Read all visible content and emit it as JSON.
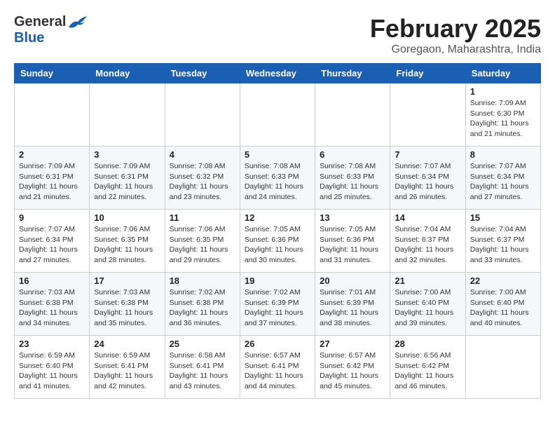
{
  "header": {
    "logo_general": "General",
    "logo_blue": "Blue",
    "month_title": "February 2025",
    "location": "Goregaon, Maharashtra, India"
  },
  "calendar": {
    "days_of_week": [
      "Sunday",
      "Monday",
      "Tuesday",
      "Wednesday",
      "Thursday",
      "Friday",
      "Saturday"
    ],
    "weeks": [
      [
        {
          "day": "",
          "info": ""
        },
        {
          "day": "",
          "info": ""
        },
        {
          "day": "",
          "info": ""
        },
        {
          "day": "",
          "info": ""
        },
        {
          "day": "",
          "info": ""
        },
        {
          "day": "",
          "info": ""
        },
        {
          "day": "1",
          "info": "Sunrise: 7:09 AM\nSunset: 6:30 PM\nDaylight: 11 hours\nand 21 minutes."
        }
      ],
      [
        {
          "day": "2",
          "info": "Sunrise: 7:09 AM\nSunset: 6:31 PM\nDaylight: 11 hours\nand 21 minutes."
        },
        {
          "day": "3",
          "info": "Sunrise: 7:09 AM\nSunset: 6:31 PM\nDaylight: 11 hours\nand 22 minutes."
        },
        {
          "day": "4",
          "info": "Sunrise: 7:08 AM\nSunset: 6:32 PM\nDaylight: 11 hours\nand 23 minutes."
        },
        {
          "day": "5",
          "info": "Sunrise: 7:08 AM\nSunset: 6:33 PM\nDaylight: 11 hours\nand 24 minutes."
        },
        {
          "day": "6",
          "info": "Sunrise: 7:08 AM\nSunset: 6:33 PM\nDaylight: 11 hours\nand 25 minutes."
        },
        {
          "day": "7",
          "info": "Sunrise: 7:07 AM\nSunset: 6:34 PM\nDaylight: 11 hours\nand 26 minutes."
        },
        {
          "day": "8",
          "info": "Sunrise: 7:07 AM\nSunset: 6:34 PM\nDaylight: 11 hours\nand 27 minutes."
        }
      ],
      [
        {
          "day": "9",
          "info": "Sunrise: 7:07 AM\nSunset: 6:34 PM\nDaylight: 11 hours\nand 27 minutes."
        },
        {
          "day": "10",
          "info": "Sunrise: 7:06 AM\nSunset: 6:35 PM\nDaylight: 11 hours\nand 28 minutes."
        },
        {
          "day": "11",
          "info": "Sunrise: 7:06 AM\nSunset: 6:35 PM\nDaylight: 11 hours\nand 29 minutes."
        },
        {
          "day": "12",
          "info": "Sunrise: 7:05 AM\nSunset: 6:36 PM\nDaylight: 11 hours\nand 30 minutes."
        },
        {
          "day": "13",
          "info": "Sunrise: 7:05 AM\nSunset: 6:36 PM\nDaylight: 11 hours\nand 31 minutes."
        },
        {
          "day": "14",
          "info": "Sunrise: 7:04 AM\nSunset: 6:37 PM\nDaylight: 11 hours\nand 32 minutes."
        },
        {
          "day": "15",
          "info": "Sunrise: 7:04 AM\nSunset: 6:37 PM\nDaylight: 11 hours\nand 33 minutes."
        }
      ],
      [
        {
          "day": "16",
          "info": "Sunrise: 7:03 AM\nSunset: 6:38 PM\nDaylight: 11 hours\nand 34 minutes."
        },
        {
          "day": "17",
          "info": "Sunrise: 7:03 AM\nSunset: 6:38 PM\nDaylight: 11 hours\nand 35 minutes."
        },
        {
          "day": "18",
          "info": "Sunrise: 7:02 AM\nSunset: 6:38 PM\nDaylight: 11 hours\nand 36 minutes."
        },
        {
          "day": "19",
          "info": "Sunrise: 7:02 AM\nSunset: 6:39 PM\nDaylight: 11 hours\nand 37 minutes."
        },
        {
          "day": "20",
          "info": "Sunrise: 7:01 AM\nSunset: 6:39 PM\nDaylight: 11 hours\nand 38 minutes."
        },
        {
          "day": "21",
          "info": "Sunrise: 7:00 AM\nSunset: 6:40 PM\nDaylight: 11 hours\nand 39 minutes."
        },
        {
          "day": "22",
          "info": "Sunrise: 7:00 AM\nSunset: 6:40 PM\nDaylight: 11 hours\nand 40 minutes."
        }
      ],
      [
        {
          "day": "23",
          "info": "Sunrise: 6:59 AM\nSunset: 6:40 PM\nDaylight: 11 hours\nand 41 minutes."
        },
        {
          "day": "24",
          "info": "Sunrise: 6:59 AM\nSunset: 6:41 PM\nDaylight: 11 hours\nand 42 minutes."
        },
        {
          "day": "25",
          "info": "Sunrise: 6:58 AM\nSunset: 6:41 PM\nDaylight: 11 hours\nand 43 minutes."
        },
        {
          "day": "26",
          "info": "Sunrise: 6:57 AM\nSunset: 6:41 PM\nDaylight: 11 hours\nand 44 minutes."
        },
        {
          "day": "27",
          "info": "Sunrise: 6:57 AM\nSunset: 6:42 PM\nDaylight: 11 hours\nand 45 minutes."
        },
        {
          "day": "28",
          "info": "Sunrise: 6:56 AM\nSunset: 6:42 PM\nDaylight: 11 hours\nand 46 minutes."
        },
        {
          "day": "",
          "info": ""
        }
      ]
    ]
  }
}
